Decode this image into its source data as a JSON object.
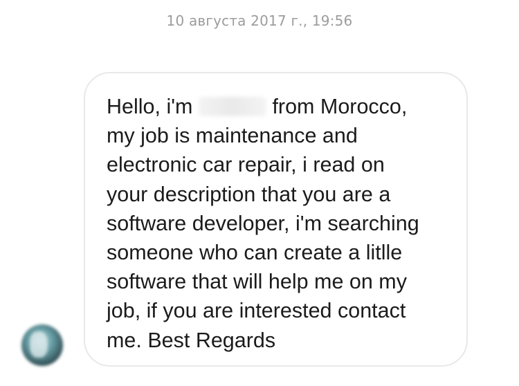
{
  "thread": {
    "timestamp": "10 августа 2017 г., 19:56"
  },
  "message": {
    "sender": {
      "avatar_icon": "avatar-blurred"
    },
    "lines": [
      {
        "before": "Hello, i'm",
        "after": "from Morocco,"
      },
      {
        "text": "my job is maintenance and"
      },
      {
        "text": "electronic car repair, i read on"
      },
      {
        "text": "your description that you are a"
      },
      {
        "text": "software developer, i'm searching"
      },
      {
        "text": "someone who can create a litlle"
      },
      {
        "text": "software that will help me on my"
      },
      {
        "text": "job, if you are interested contact"
      },
      {
        "text": "me. Best Regards"
      }
    ]
  },
  "colors": {
    "timestamp": "#9c9c9c",
    "bubble_border": "#e8e8e8",
    "text": "#1b1b1b",
    "background": "#ffffff"
  }
}
